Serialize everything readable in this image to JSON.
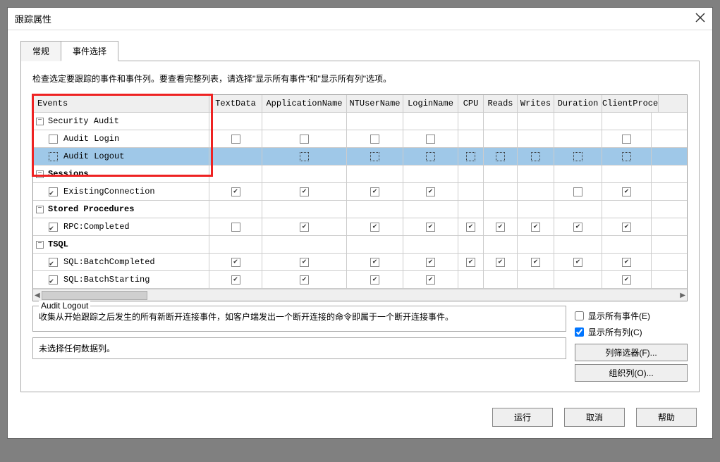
{
  "title": "跟踪属性",
  "tabs": {
    "general": "常规",
    "events": "事件选择"
  },
  "instruction": "检查选定要跟踪的事件和事件列。要查看完整列表，请选择\"显示所有事件\"和\"显示所有列\"选项。",
  "columns": {
    "events": "Events",
    "textdata": "TextData",
    "appname": "ApplicationName",
    "ntuser": "NTUserName",
    "login": "LoginName",
    "cpu": "CPU",
    "reads": "Reads",
    "writes": "Writes",
    "duration": "Duration",
    "client": "ClientProce"
  },
  "groups": {
    "security": "Security Audit",
    "sessions": "Sessions",
    "sproc": "Stored Procedures",
    "tsql": "TSQL"
  },
  "rows": {
    "auditLogin": "Audit Login",
    "auditLogout": "Audit Logout",
    "existingConn": "ExistingConnection",
    "rpcCompleted": "RPC:Completed",
    "batchCompleted": "SQL:BatchCompleted",
    "batchStarting": "SQL:BatchStarting"
  },
  "desc": {
    "legend": "Audit Logout",
    "text": "收集从开始跟踪之后发生的所有新断开连接事件，如客户端发出一个断开连接的命令即属于一个断开连接事件。"
  },
  "options": {
    "showAllEvents": "显示所有事件(E)",
    "showAllCols": "显示所有列(C)"
  },
  "noDataCol": "未选择任何数据列。",
  "filterBtn": "列筛选器(F)...",
  "orgBtn": "组织列(O)...",
  "run": "运行",
  "cancel": "取消",
  "help": "帮助"
}
